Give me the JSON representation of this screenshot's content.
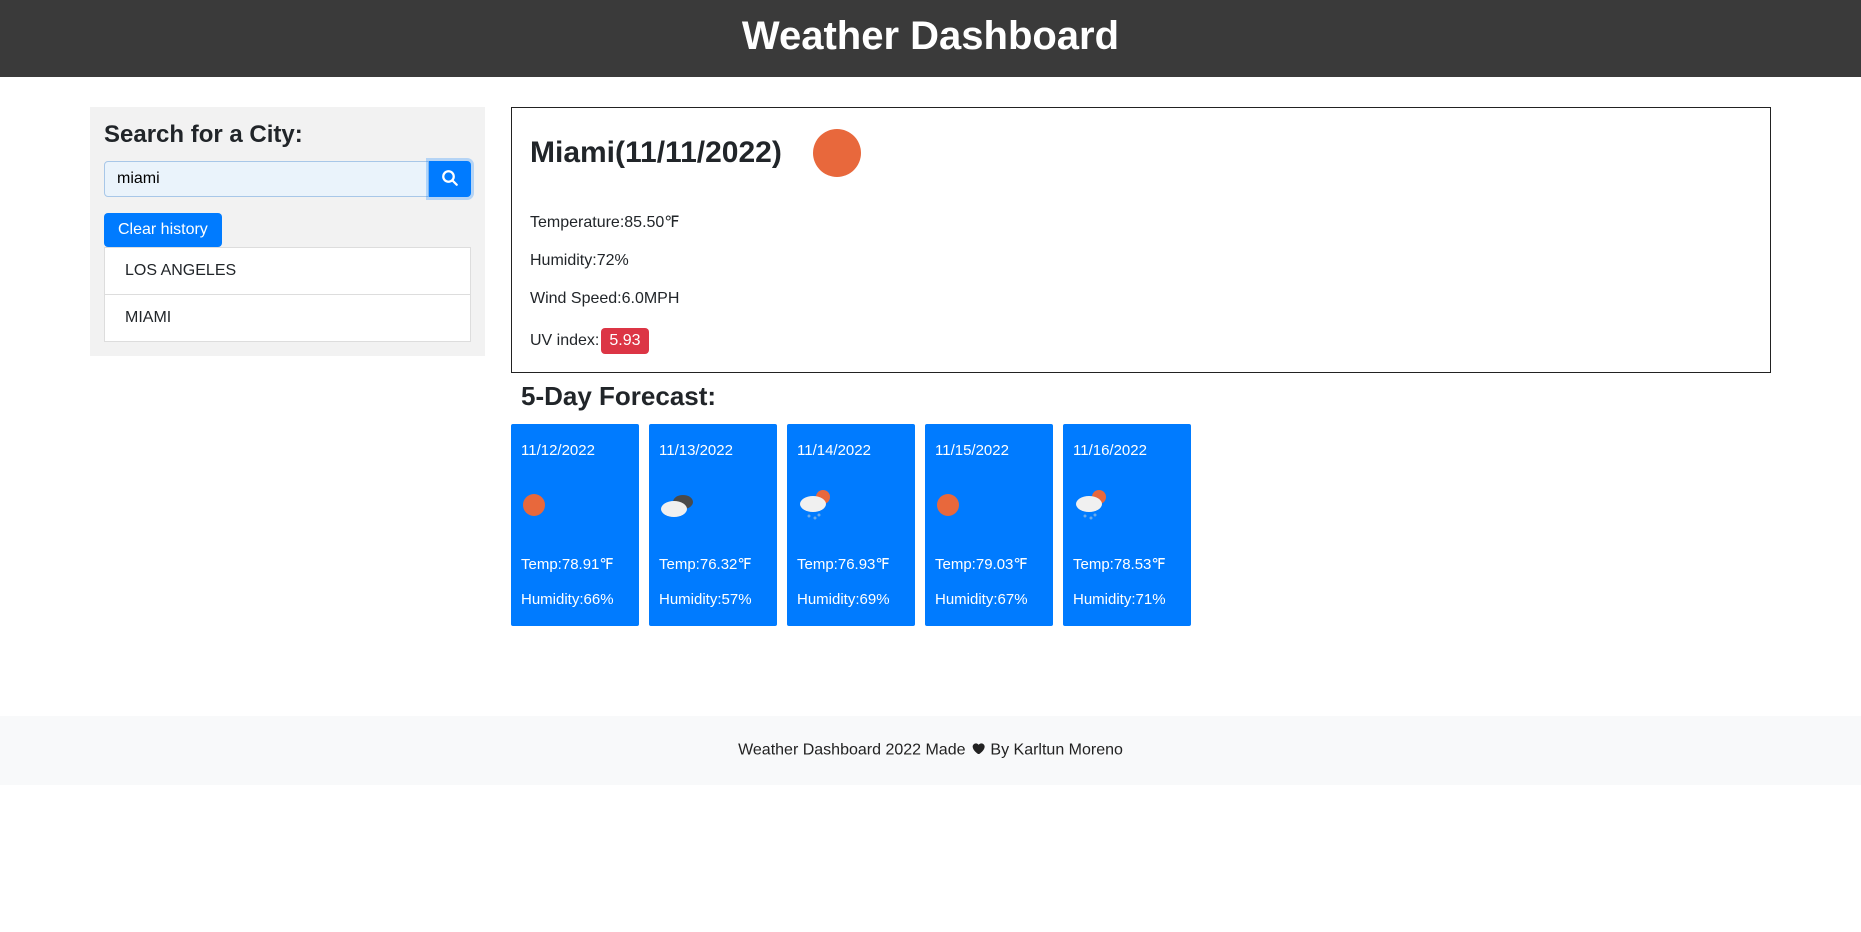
{
  "header": {
    "title": "Weather Dashboard"
  },
  "sidebar": {
    "search_label": "Search for a City:",
    "search_value": "miami",
    "clear_label": "Clear history",
    "history": [
      "LOS ANGELES",
      "MIAMI"
    ]
  },
  "current": {
    "title": "Miami(11/11/2022)",
    "icon": "sun",
    "temp_label": "Temperature:",
    "temp_value": "85.50℉",
    "humidity_label": "Humidity:",
    "humidity_value": "72%",
    "wind_label": "Wind Speed:",
    "wind_value": "6.0MPH",
    "uv_label": "UV index:",
    "uv_value": "5.93"
  },
  "forecast": {
    "title": "5-Day Forecast:",
    "days": [
      {
        "date": "11/12/2022",
        "icon": "sun",
        "temp": "Temp:78.91℉",
        "humidity": "Humidity:66%"
      },
      {
        "date": "11/13/2022",
        "icon": "clouds",
        "temp": "Temp:76.32℉",
        "humidity": "Humidity:57%"
      },
      {
        "date": "11/14/2022",
        "icon": "rain-sun",
        "temp": "Temp:76.93℉",
        "humidity": "Humidity:69%"
      },
      {
        "date": "11/15/2022",
        "icon": "sun",
        "temp": "Temp:79.03℉",
        "humidity": "Humidity:67%"
      },
      {
        "date": "11/16/2022",
        "icon": "rain-sun",
        "temp": "Temp:78.53℉",
        "humidity": "Humidity:71%"
      }
    ]
  },
  "footer": {
    "text_before": "Weather Dashboard 2022 Made ",
    "text_after": " By Karltun Moreno"
  }
}
